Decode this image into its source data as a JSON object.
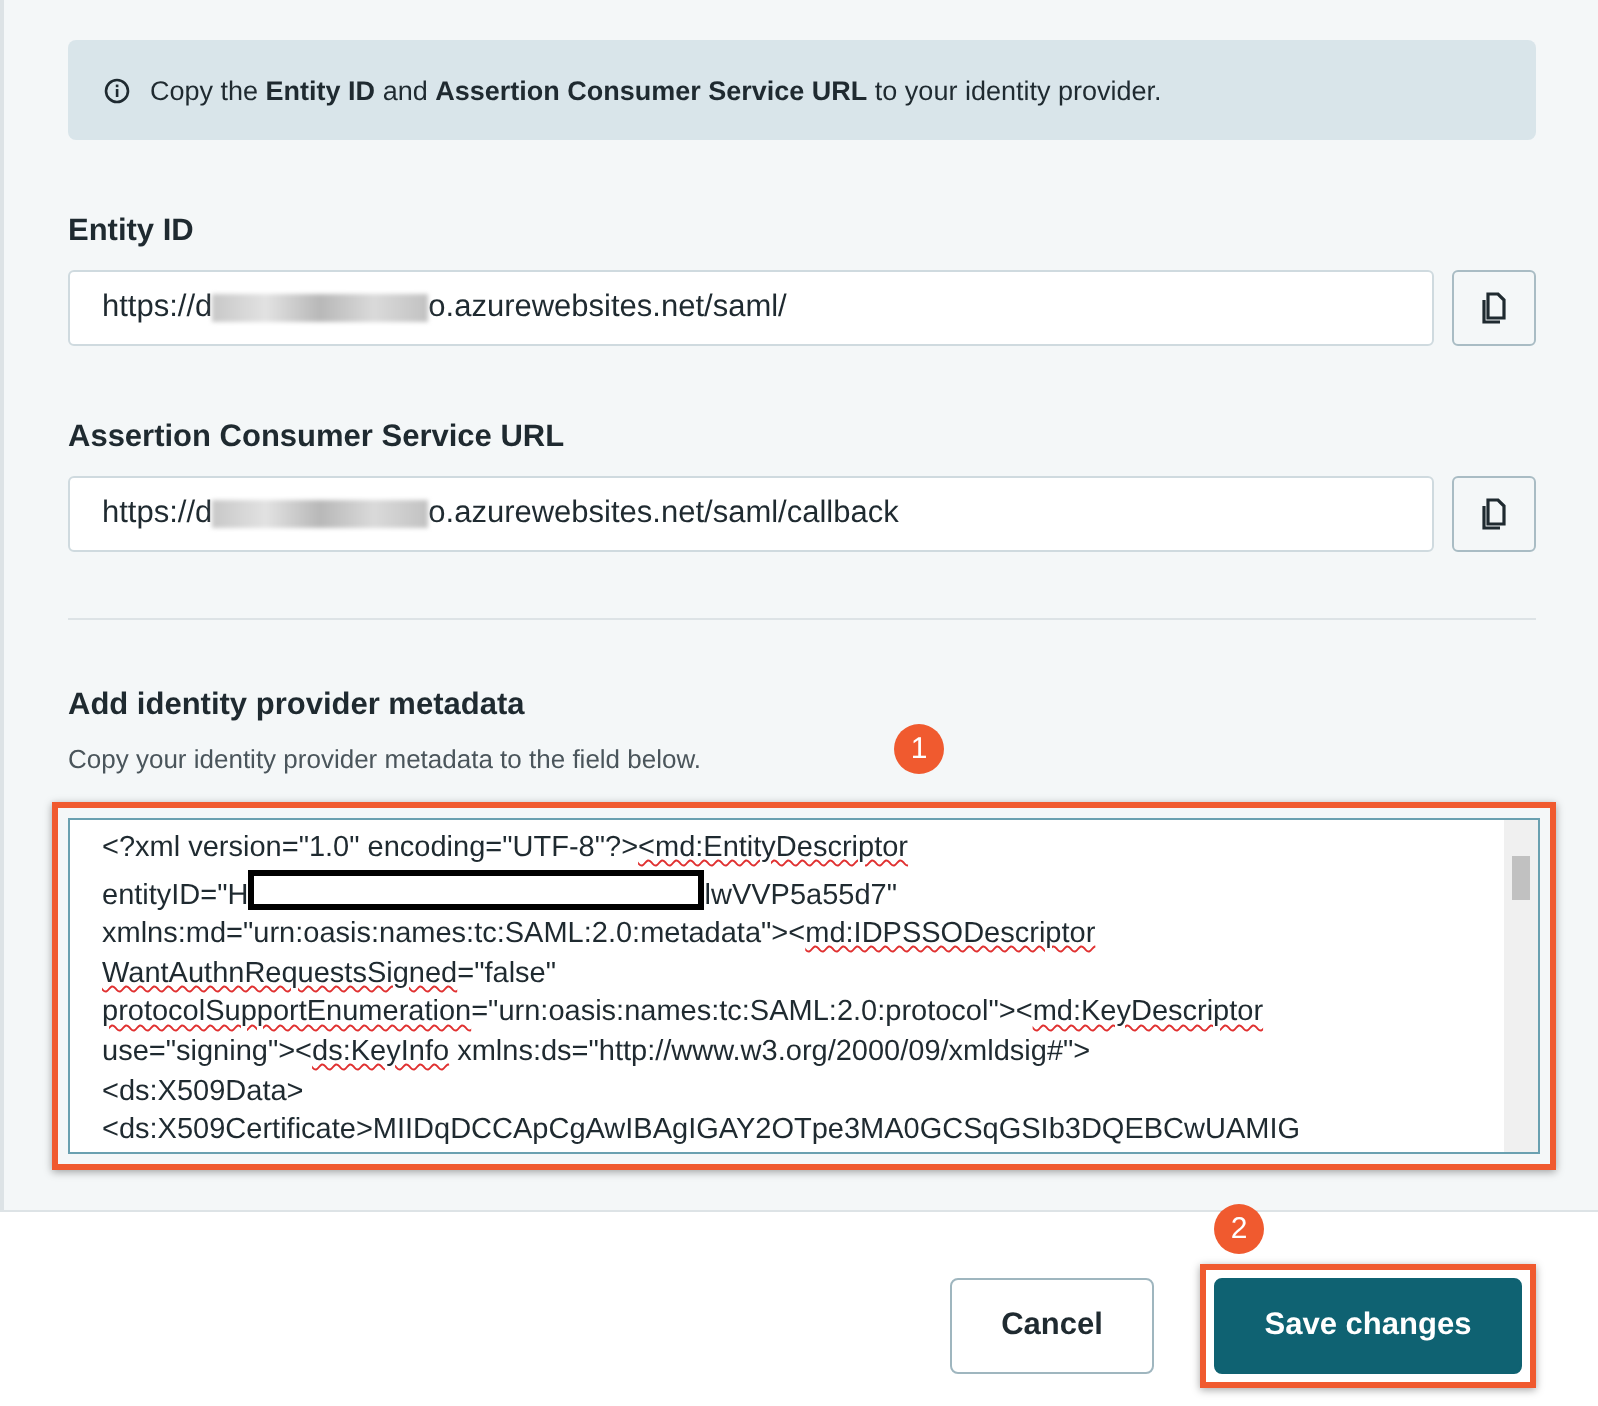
{
  "info_banner": {
    "text": "Copy the **Entity ID** and **Assertion Consumer Service URL** to your identity provider."
  },
  "fields": [
    {
      "label": "Entity ID",
      "value_start": "https://d",
      "value_end": "o.azurewebsites.net/saml/"
    },
    {
      "label": "Assertion Consumer Service URL",
      "value_start": "https://d",
      "value_end": "o.azurewebsites.net/saml/callback"
    }
  ],
  "metadata": {
    "heading": "Add identity provider metadata",
    "hint": "Copy your identity provider metadata to the field below.",
    "badge": "1",
    "highlighted": true,
    "lines": [
      {
        "parts": [
          {
            "t": "<?xml version=\"1.0\" encoding=\"UTF-8\"?>"
          },
          {
            "t": "<md:EntityDescriptor",
            "spell": true
          }
        ]
      },
      {
        "parts": [
          {
            "t": "entityID=\"H"
          },
          {
            "redacted": true
          },
          {
            "t": "lwVVP5a55d7\""
          }
        ]
      },
      {
        "parts": [
          {
            "t": "xmlns:md=\"urn:oasis:names:tc:SAML:2.0:metadata\"><"
          },
          {
            "t": "md:IDPSSODescriptor",
            "spell": true
          }
        ]
      },
      {
        "parts": [
          {
            "t": "WantAuthnRequestsSigned",
            "spell": true
          },
          {
            "t": "=\"false\""
          }
        ]
      },
      {
        "parts": [
          {
            "t": "protocolSupportEnumeration",
            "spell": true
          },
          {
            "t": "=\"urn:oasis:names:tc:SAML:2.0:protocol\"><"
          },
          {
            "t": "md:KeyDescriptor",
            "spell": true
          }
        ]
      },
      {
        "parts": [
          {
            "t": "use=\"signing\"><"
          },
          {
            "t": "ds:KeyInfo",
            "spell": true
          },
          {
            "t": " xmlns:ds=\"http://www.w3.org/2000/09/xmldsig#\">"
          }
        ]
      },
      {
        "parts": [
          {
            "t": "<ds:X509Data>"
          }
        ]
      },
      {
        "parts": [
          {
            "t": "<ds:X509Certificate>MIIDqDCCApCgAwIBAgIGAY2OTpe3MA0GCSqGSIb3DQEBCwUAMIG"
          }
        ]
      }
    ]
  },
  "buttons": [
    {
      "label": "Cancel",
      "kind": "secondary",
      "highlighted": false
    },
    {
      "label": "Save changes",
      "kind": "primary",
      "highlighted": true,
      "badge": "2"
    }
  ]
}
